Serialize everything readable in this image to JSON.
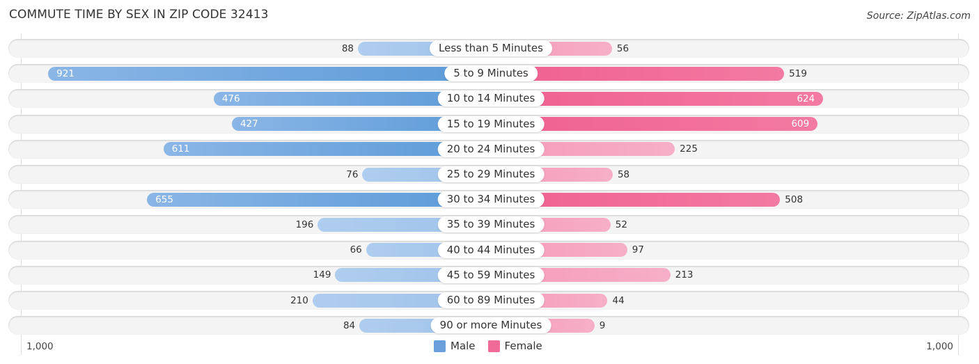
{
  "title": "COMMUTE TIME BY SEX IN ZIP CODE 32413",
  "source": "Source: ZipAtlas.com",
  "colors": {
    "male": "#6a9fdb",
    "female": "#f06b98"
  },
  "legend": [
    {
      "label": "Male",
      "color": "#6a9fdb"
    },
    {
      "label": "Female",
      "color": "#f06b98"
    }
  ],
  "axis": {
    "left_label": "1,000",
    "right_label": "1,000"
  },
  "chart_data": {
    "type": "bar",
    "orientation": "horizontal-diverging",
    "title": "COMMUTE TIME BY SEX IN ZIP CODE 32413",
    "categories": [
      "Less than 5 Minutes",
      "5 to 9 Minutes",
      "10 to 14 Minutes",
      "15 to 19 Minutes",
      "20 to 24 Minutes",
      "25 to 29 Minutes",
      "30 to 34 Minutes",
      "35 to 39 Minutes",
      "40 to 44 Minutes",
      "45 to 59 Minutes",
      "60 to 89 Minutes",
      "90 or more Minutes"
    ],
    "series": [
      {
        "name": "Male",
        "side": "left",
        "values": [
          88,
          921,
          476,
          427,
          611,
          76,
          655,
          196,
          66,
          149,
          210,
          84
        ]
      },
      {
        "name": "Female",
        "side": "right",
        "values": [
          56,
          519,
          624,
          609,
          225,
          58,
          508,
          52,
          97,
          213,
          44,
          9
        ]
      }
    ],
    "xlim": [
      -1000,
      1000
    ],
    "tick_labels": [
      "1,000",
      "1,000"
    ],
    "legend_position": "bottom-center",
    "grid": false
  }
}
